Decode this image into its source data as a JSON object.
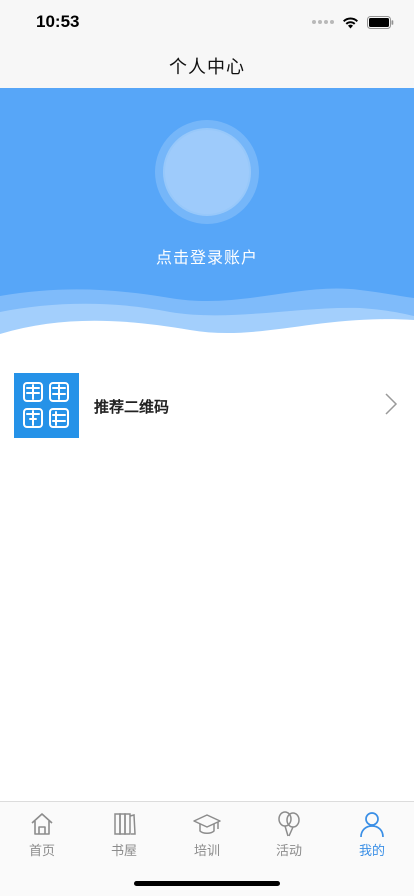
{
  "status_bar": {
    "time": "10:53"
  },
  "nav": {
    "title": "个人中心"
  },
  "profile": {
    "login_prompt": "点击登录账户"
  },
  "menu": [
    {
      "label": "推荐二维码",
      "icon": "app-logo-icon"
    }
  ],
  "tabs": [
    {
      "label": "首页",
      "icon": "home-icon",
      "active": false
    },
    {
      "label": "书屋",
      "icon": "books-icon",
      "active": false
    },
    {
      "label": "培训",
      "icon": "graduation-cap-icon",
      "active": false
    },
    {
      "label": "活动",
      "icon": "balloons-icon",
      "active": false
    },
    {
      "label": "我的",
      "icon": "person-icon",
      "active": true
    }
  ],
  "colors": {
    "header_blue": "#57a6f8",
    "accent": "#3a8fe6",
    "inactive_tab": "#8c8c8c"
  }
}
